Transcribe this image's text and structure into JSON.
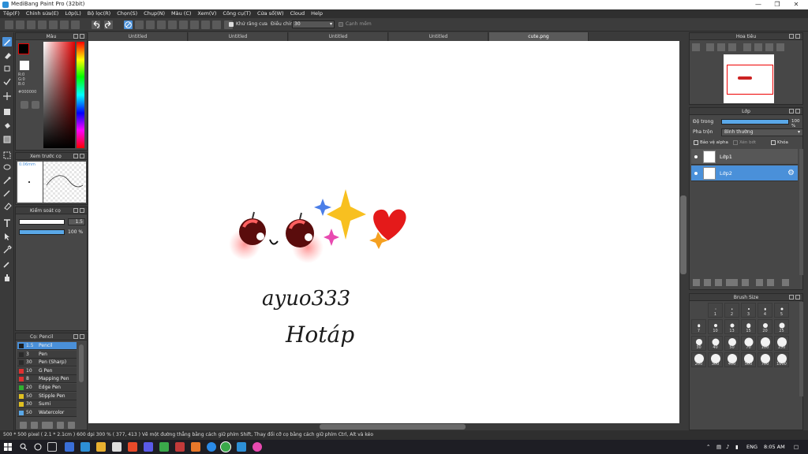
{
  "window": {
    "title": "MediBang Paint Pro (32bit)"
  },
  "menu": [
    "Tệp(F)",
    "Chỉnh sửa(E)",
    "Lớp(L)",
    "Bộ lọc(R)",
    "Chọn(S)",
    "Chụp(N)",
    "Màu (C)",
    "Xem(V)",
    "Công cụ(T)",
    "Cửa sổ(W)",
    "Cloud",
    "Help"
  ],
  "toolbar": {
    "antialias_label": "Khử răng cưa",
    "adjust_label": "Điều chỉnh",
    "adjust_value": "30",
    "smooth_label": "Cạnh mềm"
  },
  "color_panel": {
    "title": "Màu",
    "r": "R:0",
    "g": "G:0",
    "b": "B:0",
    "hex": "#000000"
  },
  "brush_preview": {
    "title": "Xem trước cọ",
    "size": "0.06mm"
  },
  "brush_control": {
    "title": "Kiểm soát cọ",
    "size_value": "1.5",
    "opacity_value": "100 %",
    "opacity": 1.0
  },
  "brush_list": {
    "title": "Cọ: Pencil",
    "items": [
      {
        "size": "1.5",
        "name": "Pencil",
        "color": "#1e1e1e"
      },
      {
        "size": "3",
        "name": "Pen",
        "color": "#2a2a2a"
      },
      {
        "size": "30",
        "name": "Pen (Sharp)",
        "color": "#2a2a2a"
      },
      {
        "size": "10",
        "name": "G Pen",
        "color": "#e03030"
      },
      {
        "size": "8",
        "name": "Mapping Pen",
        "color": "#e03030"
      },
      {
        "size": "20",
        "name": "Edge Pen",
        "color": "#30b030"
      },
      {
        "size": "50",
        "name": "Stipple Pen",
        "color": "#e0c020"
      },
      {
        "size": "30",
        "name": "Sumi",
        "color": "#e0c020"
      },
      {
        "size": "50",
        "name": "Watercolor",
        "color": "#5aa8e8"
      }
    ]
  },
  "tabs": [
    {
      "label": "Untitled"
    },
    {
      "label": "Untitled"
    },
    {
      "label": "Untitled"
    },
    {
      "label": "Untitled"
    },
    {
      "label": "cute.png"
    }
  ],
  "canvas_text": {
    "line1": "ayuo333",
    "line2": "Hotáp"
  },
  "navigator": {
    "title": "Hoa tiêu"
  },
  "layers": {
    "title": "Lớp",
    "opacity_label": "Độ trong",
    "opacity_value": "100 %",
    "opacity": 1.0,
    "blend_label": "Pha trộn",
    "blend_value": "Bình thường",
    "protect_alpha": "Bảo vệ alpha",
    "clip": "Xén bớt",
    "lock": "Khóa",
    "items": [
      {
        "name": "Lớp1",
        "selected": false
      },
      {
        "name": "Lớp2",
        "selected": true
      }
    ]
  },
  "brush_size": {
    "title": "Brush Size",
    "sizes": [
      "1",
      "2",
      "3",
      "4",
      "5",
      "7",
      "10",
      "13",
      "15",
      "20",
      "25",
      "30",
      "40",
      "50",
      "70",
      "100",
      "150",
      "200",
      "300",
      "400",
      "500",
      "700",
      "1000"
    ]
  },
  "status": {
    "text": "500 * 500 pixel   ( 2.1 * 2.1cm )   600 dpi   300 %   ( 377, 413 )   Vẽ một đường thẳng bằng cách giữ phím Shift, Thay đổi cỡ cọ bằng cách giữ phím Ctrl, Alt và kéo"
  },
  "taskbar": {
    "lang": "ENG",
    "time": "8:05 AM"
  },
  "colors": {
    "accent": "#4a90d9",
    "panel": "#474747",
    "dark": "#2f2f2f"
  }
}
